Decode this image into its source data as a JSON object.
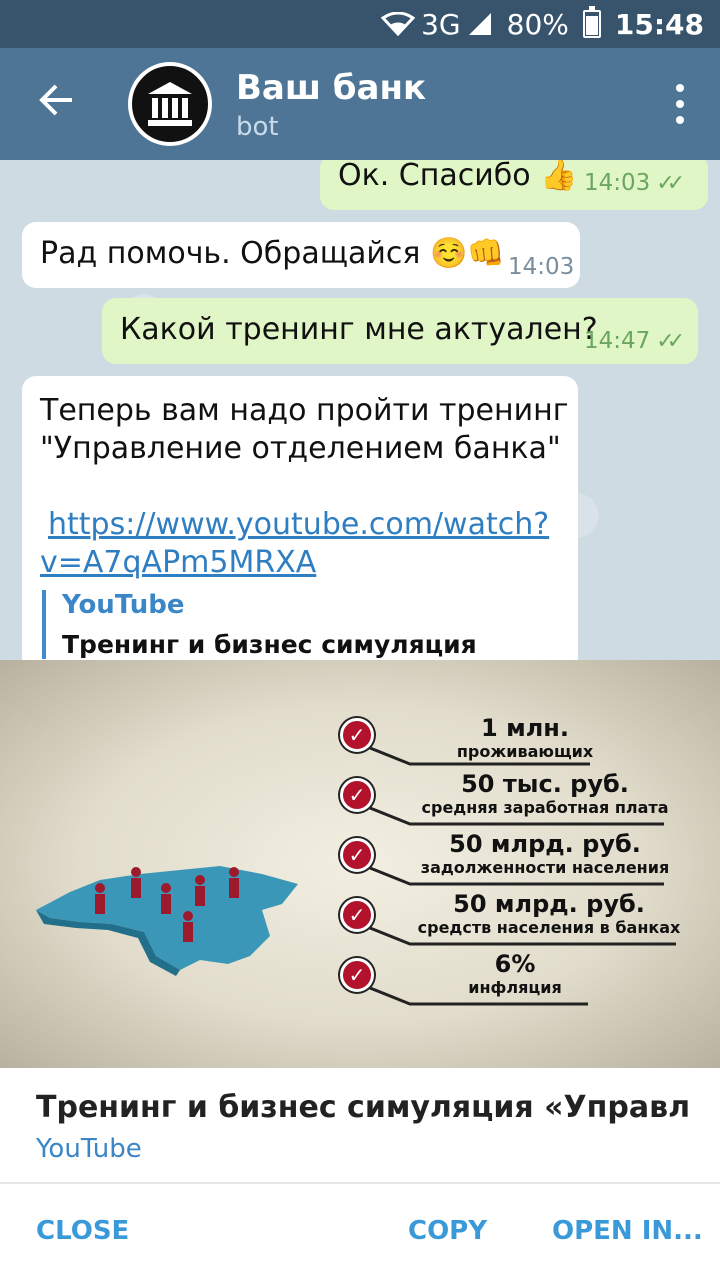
{
  "status_bar": {
    "network": "3G",
    "battery": "80%",
    "time": "15:48"
  },
  "header": {
    "title": "Ваш банк",
    "subtitle": "bot"
  },
  "messages": [
    {
      "text": "Ок. Спасибо 👍",
      "time": "14:03"
    },
    {
      "text": "Рад помочь. Обращайся ☺️👊",
      "time": "14:03"
    },
    {
      "text": "Какой тренинг мне актуален?",
      "time": "14:47"
    },
    {
      "line1": "Теперь вам надо пройти тренинг",
      "line2": "\"Управление отделением банка\"",
      "link1": "https://www.youtube.com/watch?",
      "link2": "v=A7qAPm5MRXA",
      "preview_site": "YouTube",
      "preview_title": "Тренинг и бизнес симуляция"
    }
  ],
  "image_stats": [
    {
      "big": "1 млн.",
      "small": "проживающих"
    },
    {
      "big": "50 тыс. руб.",
      "small": "средняя заработная плата"
    },
    {
      "big": "50 млрд. руб.",
      "small": "задолженности населения"
    },
    {
      "big": "50 млрд. руб.",
      "small": "средств населения в банках"
    },
    {
      "big": "6%",
      "small": "инфляция"
    }
  ],
  "sheet": {
    "title": "Тренинг и бизнес симуляция «Управлени…",
    "subtitle": "YouTube",
    "close_label": "CLOSE",
    "copy_label": "COPY",
    "open_label": "OPEN IN..."
  },
  "colors": {
    "header": "#4f7596",
    "statusbar": "#37546c",
    "accent": "#3a9ad9",
    "out_bubble": "#e1f6c6",
    "check_red": "#b3122d"
  }
}
